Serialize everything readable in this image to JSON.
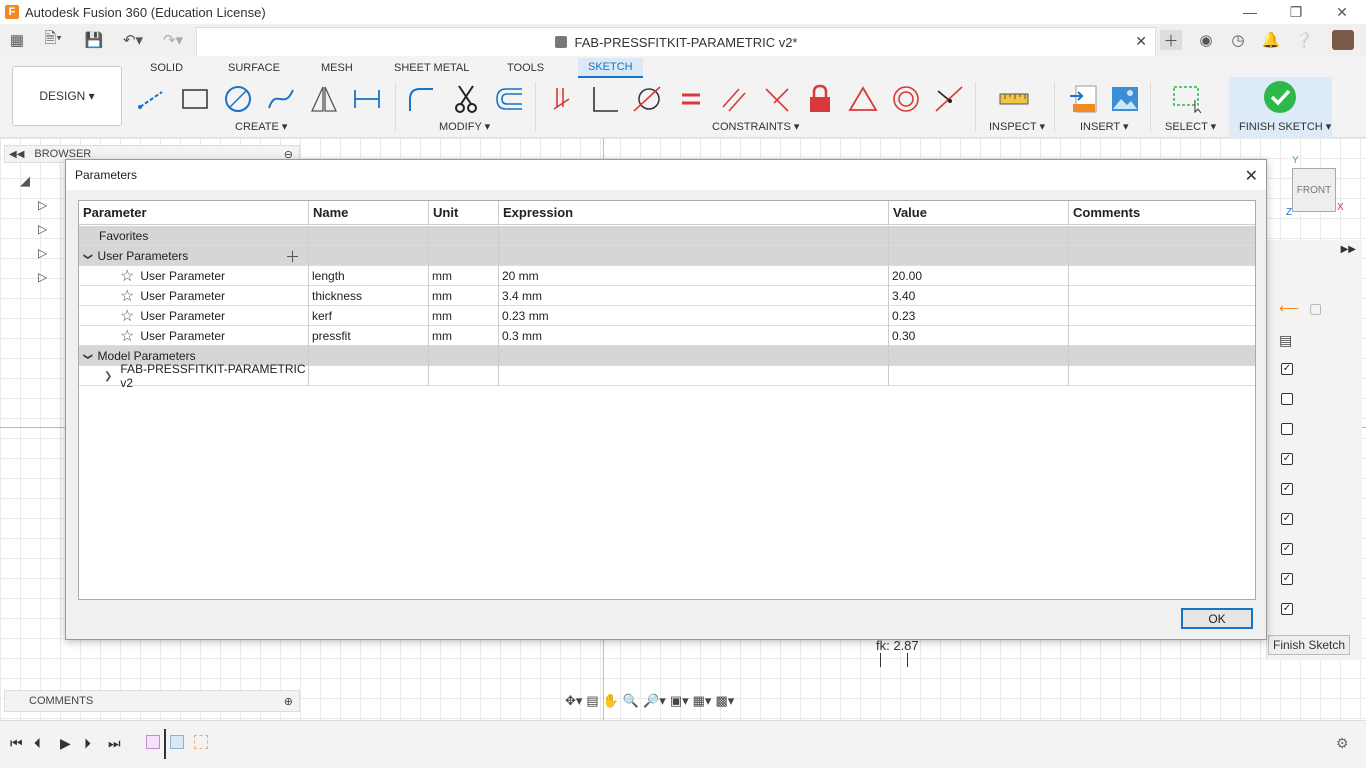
{
  "window": {
    "title": "Autodesk Fusion 360 (Education License)",
    "logo_letter": "F"
  },
  "document": {
    "tab_title": "FAB-PRESSFITKIT-PARAMETRIC v2*"
  },
  "toolbar": {
    "workspace": "DESIGN",
    "tabs": [
      "SOLID",
      "SURFACE",
      "MESH",
      "SHEET METAL",
      "TOOLS",
      "SKETCH"
    ],
    "active_tab": "SKETCH",
    "groups": {
      "create": "CREATE",
      "modify": "MODIFY",
      "constraints": "CONSTRAINTS",
      "inspect": "INSPECT",
      "insert": "INSERT",
      "select": "SELECT",
      "finish": "FINISH SKETCH"
    }
  },
  "browser": {
    "label": "BROWSER"
  },
  "comments": {
    "label": "COMMENTS"
  },
  "viewcube": {
    "label": "FRONT",
    "axis_y": "Y",
    "axis_x": "X",
    "axis_z": "Z"
  },
  "sketch_palette": {
    "finish_button": "Finish Sketch"
  },
  "dimension_text": "fk: 2.87",
  "dialog": {
    "title": "Parameters",
    "columns": [
      "Parameter",
      "Name",
      "Unit",
      "Expression",
      "Value",
      "Comments"
    ],
    "favorites_label": "Favorites",
    "user_params_label": "User Parameters",
    "model_params_label": "Model Parameters",
    "user_params": [
      {
        "type": "User Parameter",
        "name": "length",
        "unit": "mm",
        "expression": "20 mm",
        "value": "20.00"
      },
      {
        "type": "User Parameter",
        "name": "thickness",
        "unit": "mm",
        "expression": "3.4 mm",
        "value": "3.40"
      },
      {
        "type": "User Parameter",
        "name": "kerf",
        "unit": "mm",
        "expression": "0.23 mm",
        "value": "0.23"
      },
      {
        "type": "User Parameter",
        "name": "pressfit",
        "unit": "mm",
        "expression": "0.3 mm",
        "value": "0.30"
      }
    ],
    "model_item": "FAB-PRESSFITKIT-PARAMETRIC v2",
    "ok_label": "OK"
  },
  "colors": {
    "accent": "#1a73c6",
    "finish_green": "#2db84b",
    "constraint_red": "#d9393a"
  }
}
